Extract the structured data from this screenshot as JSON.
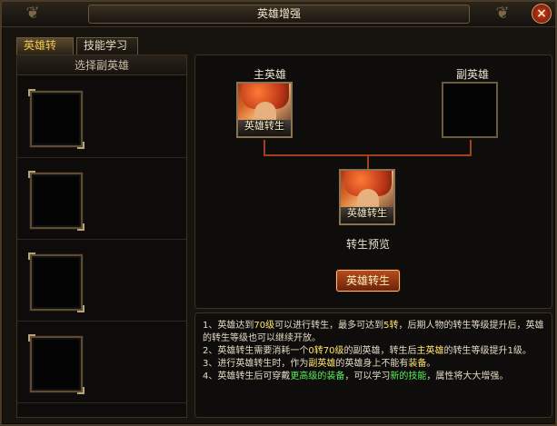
{
  "window": {
    "title": "英雄增强"
  },
  "tabs": [
    "英雄转生",
    "技能学习"
  ],
  "left_panel": {
    "title": "选择副英雄"
  },
  "slots": 4,
  "right_panel": {
    "main_label": "主英雄",
    "sub_label": "副英雄",
    "preview_label": "转生预览",
    "overlay_text": "英雄转生",
    "button": "英雄转生"
  },
  "notes": {
    "l1a": "1、英雄达到",
    "l1b": "70级",
    "l1c": "可以进行转生，最多可达到",
    "l1d": "5转",
    "l1e": "，后期人物的转生等级提升后，英雄的转生等级也可以继续开放。",
    "l2a": "2、英雄转生需要消耗一个",
    "l2b": "0转70级",
    "l2c": "的副英雄，转生后",
    "l2d": "主英雄",
    "l2e": "的转生等级提升1级。",
    "l3a": "3、进行英雄转生时，作为",
    "l3b": "副英雄",
    "l3c": "的英雄身上不能有",
    "l3d": "装备",
    "l3e": "。",
    "l4a": "4、英雄转生后可穿戴",
    "l4b": "更高级的装备",
    "l4c": "，可以学习",
    "l4d": "新的技能",
    "l4e": "，属性将大大增强。"
  }
}
